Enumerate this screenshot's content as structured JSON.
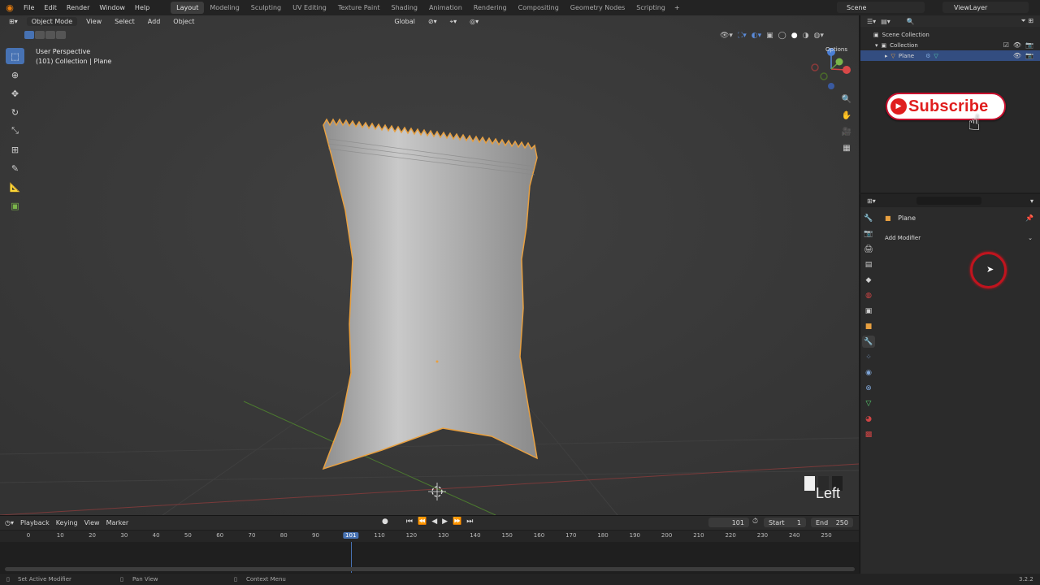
{
  "topbar": {
    "menus": [
      "File",
      "Edit",
      "Render",
      "Window",
      "Help"
    ],
    "workspace_tabs": [
      "Layout",
      "Modeling",
      "Sculpting",
      "UV Editing",
      "Texture Paint",
      "Shading",
      "Animation",
      "Rendering",
      "Compositing",
      "Geometry Nodes",
      "Scripting"
    ],
    "active_tab": "Layout",
    "scene": "Scene",
    "view_layer": "ViewLayer"
  },
  "viewport": {
    "mode": "Object Mode",
    "menus": [
      "View",
      "Select",
      "Add",
      "Object"
    ],
    "transform_orientation": "Global",
    "options_label": "Options",
    "info_line1": "User Perspective",
    "info_line2": "(101) Collection | Plane",
    "key_label": "Left"
  },
  "outliner": {
    "scene_collection": "Scene Collection",
    "collection": "Collection",
    "object": "Plane"
  },
  "overlay": {
    "subscribe_label": "Subscribe"
  },
  "properties": {
    "object_name": "Plane",
    "add_modifier": "Add Modifier"
  },
  "timeline": {
    "menus": [
      "Playback",
      "Keying",
      "View",
      "Marker"
    ],
    "current_frame": "101",
    "start_label": "Start",
    "start_value": "1",
    "end_label": "End",
    "end_value": "250",
    "ticks": [
      "0",
      "10",
      "20",
      "30",
      "40",
      "50",
      "60",
      "70",
      "80",
      "90",
      "101",
      "110",
      "120",
      "130",
      "140",
      "150",
      "160",
      "170",
      "180",
      "190",
      "200",
      "210",
      "220",
      "230",
      "240",
      "250"
    ]
  },
  "statusbar": {
    "left": "Set Active Modifier",
    "middle": "Pan View",
    "right": "Context Menu",
    "version": "3.2.2"
  }
}
